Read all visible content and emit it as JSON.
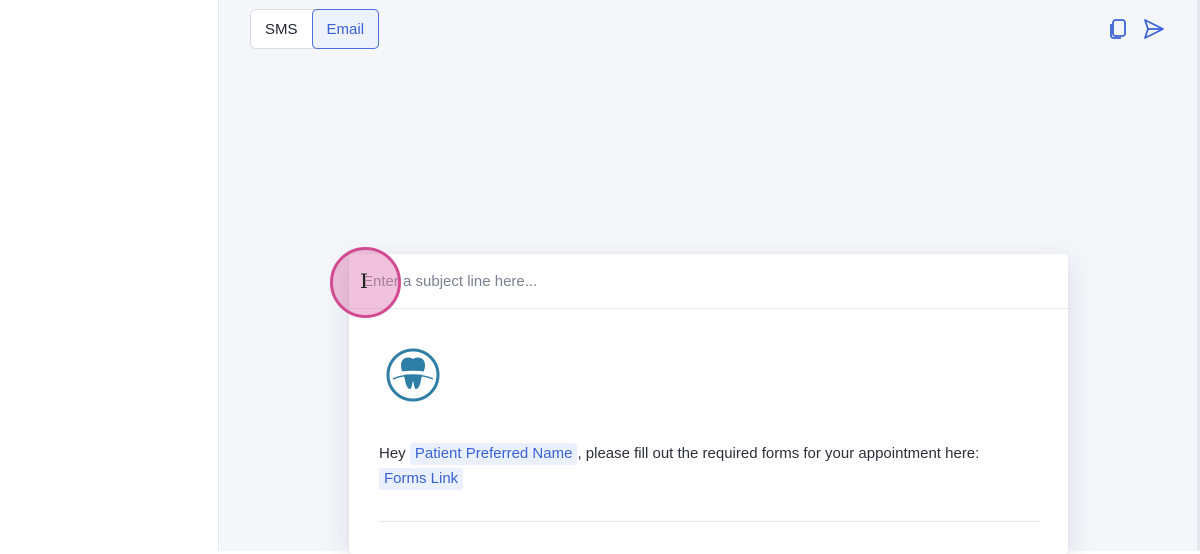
{
  "toggle": {
    "sms_label": "SMS",
    "email_label": "Email",
    "selected": "Email"
  },
  "toolbar": {
    "icons": [
      "copy-icon",
      "send-icon"
    ]
  },
  "email": {
    "subject_placeholder": "Enter a subject line here...",
    "subject_value": "",
    "logo_icon": "tooth-logo-icon",
    "message": {
      "greeting": "Hey",
      "name_token": "Patient Preferred Name",
      "text": ", please fill out the required forms for your appointment here:",
      "link_token": "Forms Link"
    }
  },
  "colors": {
    "accent": "#3a63d6",
    "token_bg": "#eaf0fd",
    "logo": "#2e7ea6",
    "click_indicator": "#d24b92"
  }
}
